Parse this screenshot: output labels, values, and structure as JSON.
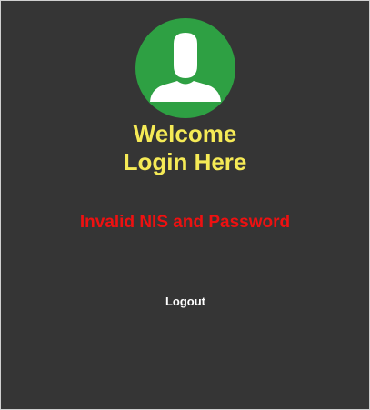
{
  "avatar": {
    "icon": "user-silhouette-icon",
    "background_color": "#2ea043",
    "figure_color": "#ffffff"
  },
  "welcome": {
    "line1": "Welcome",
    "line2": "Login Here",
    "color": "#f5ea56"
  },
  "error": {
    "message": "Invalid NIS and Password",
    "color": "#ee1111"
  },
  "actions": {
    "logout_label": "Logout"
  },
  "theme": {
    "panel_background": "#353535"
  }
}
